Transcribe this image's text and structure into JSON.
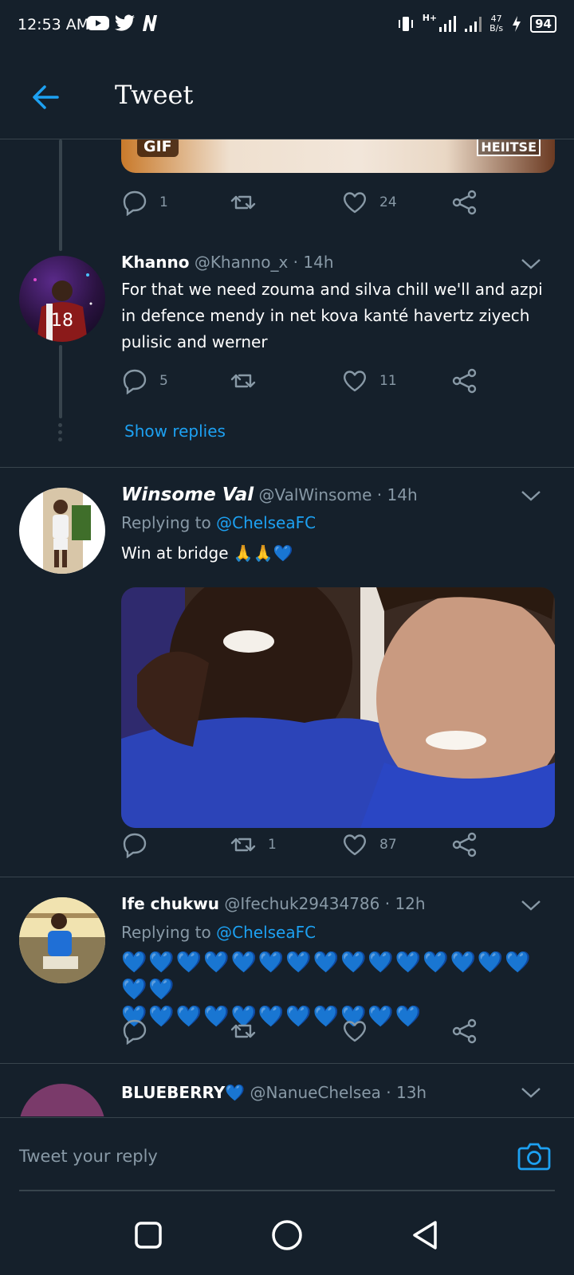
{
  "status_bar": {
    "time": "12:53 AM",
    "apps": [
      "youtube-icon",
      "twitter-icon",
      "netflix-icon"
    ],
    "network": "H+",
    "speed_value": "47",
    "speed_unit": "B/s",
    "battery": "94"
  },
  "header": {
    "title": "Tweet"
  },
  "gif_tweet": {
    "badge": "GIF",
    "watermark": "HEIITSE",
    "reply_count": "1",
    "retweet_count": "",
    "like_count": "24"
  },
  "tweets": [
    {
      "name": "Khanno",
      "handle": "@Khanno_x",
      "time": "· 14h",
      "text": "For that we need zouma and silva chill we'll and azpi in defence mendy in net kova kanté havertz ziyech pulisic and werner",
      "reply_count": "5",
      "retweet_count": "",
      "like_count": "11",
      "show_replies": "Show replies"
    },
    {
      "name": "Winsome Val",
      "handle": "@ValWinsome",
      "time": "· 14h",
      "replying_label": "Replying to",
      "replying_handle": "@ChelseaFC",
      "text": "Win at bridge 🙏🙏💙",
      "reply_count": "",
      "retweet_count": "1",
      "like_count": "87"
    },
    {
      "name": "Ife chukwu",
      "handle": "@Ifechuk29434786",
      "time": "· 12h",
      "replying_label": "Replying to",
      "replying_handle": "@ChelseaFC",
      "text_line1": "💙💙💙💙💙💙💙💙💙💙💙💙💙💙💙💙💙",
      "text_line2": "💙💙💙💙💙💙💙💙💙💙💙",
      "reply_count": "",
      "retweet_count": "",
      "like_count": ""
    },
    {
      "name": "BLUEBERRY💙",
      "handle": "@NanueChelsea",
      "time": "· 13h"
    }
  ],
  "reply_bar": {
    "placeholder": "Tweet your reply"
  },
  "colors": {
    "background": "#15202b",
    "accent": "#1da1f2",
    "muted": "#8899a6",
    "divider": "#38444d"
  }
}
